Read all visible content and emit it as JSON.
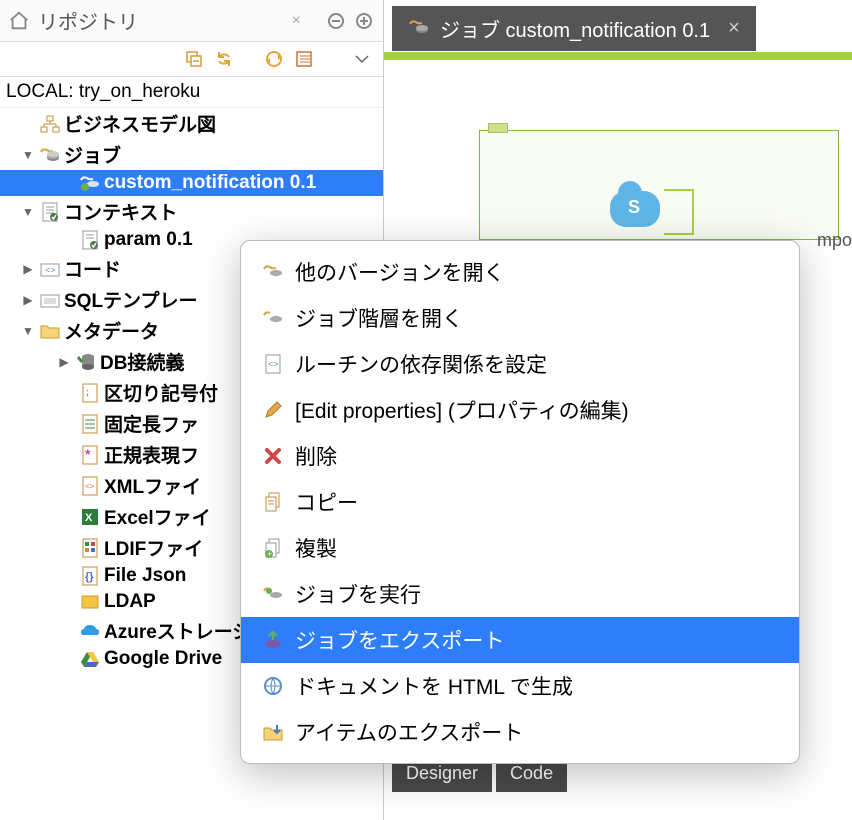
{
  "sidebar": {
    "title": "リポジトリ",
    "project_label": "LOCAL: try_on_heroku",
    "nodes": {
      "business_model": "ビジネスモデル図",
      "job": "ジョブ",
      "selected_job": "custom_notification 0.1",
      "context": "コンテキスト",
      "param": "param 0.1",
      "code": "コード",
      "sql_templates": "SQLテンプレー",
      "metadata": "メタデータ",
      "db_connection": "DB接続義",
      "delimiter": "区切り記号付",
      "fixed_length": "固定長ファ",
      "regex": "正規表現フ",
      "xml_file": "XMLファイ",
      "excel_file": "Excelファイ",
      "ldif_file": "LDIFファイ",
      "file_json": "File Json",
      "ldap": "LDAP",
      "azure_storage": "Azureストレージ",
      "google_drive": "Google Drive"
    }
  },
  "context_menu": {
    "open_other_version": "他のバージョンを開く",
    "open_job_hierarchy": "ジョブ階層を開く",
    "set_routine_dependencies": "ルーチンの依存関係を設定",
    "edit_properties": "[Edit properties] (プロパティの編集)",
    "delete": "削除",
    "copy": "コピー",
    "duplicate": "複製",
    "run_job": "ジョブを実行",
    "export_job": "ジョブをエクスポート",
    "generate_html_doc": "ドキュメントを HTML で生成",
    "export_item": "アイテムのエクスポート"
  },
  "designer": {
    "tab_label": "ジョブ custom_notification 0.1",
    "compo_text": "mpo",
    "bottom_tabs": {
      "designer": "Designer",
      "code": "Code"
    }
  }
}
